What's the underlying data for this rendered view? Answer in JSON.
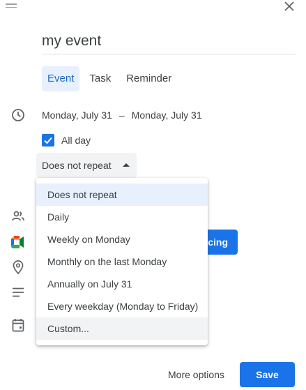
{
  "event": {
    "title": "my event"
  },
  "tabs": [
    {
      "label": "Event",
      "active": true
    },
    {
      "label": "Task",
      "active": false
    },
    {
      "label": "Reminder",
      "active": false
    }
  ],
  "dates": {
    "start": "Monday, July 31",
    "separator": "–",
    "end": "Monday, July 31"
  },
  "all_day": {
    "label": "All day",
    "checked": true
  },
  "repeat": {
    "selected": "Does not repeat",
    "options": [
      "Does not repeat",
      "Daily",
      "Weekly on Monday",
      "Monthly on the last Monday",
      "Annually on July 31",
      "Every weekday (Monday to Friday)",
      "Custom..."
    ]
  },
  "meet_button": {
    "label": "cing"
  },
  "footer": {
    "more_options": "More options",
    "save": "Save"
  },
  "colors": {
    "accent": "#1a73e8",
    "active_tab_bg": "#e8f0fe",
    "active_tab_text": "#1967d2",
    "text": "#3c4043",
    "icon": "#5f6368"
  },
  "icons": [
    "drag-handle-icon",
    "close-icon",
    "clock-icon",
    "people-icon",
    "meet-icon",
    "location-icon",
    "description-icon",
    "calendar-icon"
  ]
}
